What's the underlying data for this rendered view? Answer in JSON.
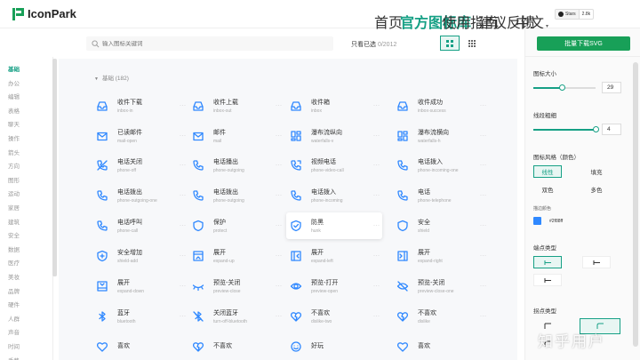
{
  "header": {
    "logo_text": "IconPark",
    "nav": [
      {
        "label": "首页",
        "active": false
      },
      {
        "label": "官方图标库",
        "active": true
      },
      {
        "label": "使用指南",
        "active": false
      },
      {
        "label": "建议反馈",
        "active": false
      }
    ],
    "lang": "中文",
    "github": {
      "label": "Stars",
      "count": "2.8k"
    }
  },
  "sidebar": {
    "items": [
      {
        "label": "基础",
        "active": true
      },
      {
        "label": "办公",
        "active": false
      },
      {
        "label": "编辑",
        "active": false
      },
      {
        "label": "表格",
        "active": false
      },
      {
        "label": "聊天",
        "active": false
      },
      {
        "label": "操作",
        "active": false
      },
      {
        "label": "箭头",
        "active": false
      },
      {
        "label": "方向",
        "active": false
      },
      {
        "label": "图形",
        "active": false
      },
      {
        "label": "运动",
        "active": false
      },
      {
        "label": "家居",
        "active": false
      },
      {
        "label": "建筑",
        "active": false
      },
      {
        "label": "安全",
        "active": false
      },
      {
        "label": "数据",
        "active": false
      },
      {
        "label": "医疗",
        "active": false
      },
      {
        "label": "美妆",
        "active": false
      },
      {
        "label": "品牌",
        "active": false
      },
      {
        "label": "硬件",
        "active": false
      },
      {
        "label": "人群",
        "active": false
      },
      {
        "label": "声音",
        "active": false
      },
      {
        "label": "时间",
        "active": false
      },
      {
        "label": "手势",
        "active": false
      }
    ]
  },
  "search": {
    "placeholder": "输入图标关键词"
  },
  "only_selected": {
    "label": "只看已选",
    "count": "0/2012"
  },
  "section": {
    "title": "基础 (182)"
  },
  "icons": [
    {
      "name": "收件下载",
      "code": "inbox-in",
      "icon": "inbox-in-icon"
    },
    {
      "name": "收件上载",
      "code": "inbox-out",
      "icon": "inbox-out-icon"
    },
    {
      "name": "收件箱",
      "code": "inbox",
      "icon": "inbox-icon"
    },
    {
      "name": "收件成功",
      "code": "inbox-success",
      "icon": "inbox-success-icon"
    },
    {
      "name": "已读邮件",
      "code": "mail-open",
      "icon": "mail-open-icon"
    },
    {
      "name": "邮件",
      "code": "mail",
      "icon": "mail-icon"
    },
    {
      "name": "瀑布流纵向",
      "code": "waterfalls-v",
      "icon": "waterfalls-v-icon"
    },
    {
      "name": "瀑布流横向",
      "code": "waterfalls-h",
      "icon": "waterfalls-h-icon"
    },
    {
      "name": "电话关闭",
      "code": "phone-off",
      "icon": "phone-off-icon"
    },
    {
      "name": "电话播出",
      "code": "phone-outgoing",
      "icon": "phone-outgoing-icon"
    },
    {
      "name": "视频电话",
      "code": "phone-video-call",
      "icon": "phone-video-call-icon"
    },
    {
      "name": "电话拨入",
      "code": "phone-incoming-one",
      "icon": "phone-incoming-icon"
    },
    {
      "name": "电话拨出",
      "code": "phone-outgoing-one",
      "icon": "phone-outgoing-one-icon"
    },
    {
      "name": "电话拨出",
      "code": "phone-outgoing",
      "icon": "phone-outgoing-icon"
    },
    {
      "name": "电话拨入",
      "code": "phone-incoming",
      "icon": "phone-incoming-icon"
    },
    {
      "name": "电话",
      "code": "phone-telephone",
      "icon": "phone-icon"
    },
    {
      "name": "电话呼叫",
      "code": "phone-call",
      "icon": "phone-call-icon"
    },
    {
      "name": "保护",
      "code": "protect",
      "icon": "protect-icon"
    },
    {
      "name": "防黑",
      "code": "hunk",
      "icon": "shield-check-icon"
    },
    {
      "name": "安全",
      "code": "shield",
      "icon": "shield-icon"
    },
    {
      "name": "安全增加",
      "code": "shield-add",
      "icon": "shield-add-icon"
    },
    {
      "name": "展开",
      "code": "expand-up",
      "icon": "expand-up-icon"
    },
    {
      "name": "展开",
      "code": "expand-left",
      "icon": "expand-left-icon"
    },
    {
      "name": "展开",
      "code": "expand-right",
      "icon": "expand-right-icon"
    },
    {
      "name": "展开",
      "code": "expand-down",
      "icon": "expand-down-icon"
    },
    {
      "name": "预览-关闭",
      "code": "preview-close",
      "icon": "preview-close-icon"
    },
    {
      "name": "预览-打开",
      "code": "preview-open",
      "icon": "preview-open-icon"
    },
    {
      "name": "预览-关闭",
      "code": "preview-close-one",
      "icon": "preview-close-one-icon"
    },
    {
      "name": "蓝牙",
      "code": "bluetooth",
      "icon": "bluetooth-icon"
    },
    {
      "name": "关闭蓝牙",
      "code": "turn-off-bluetooth",
      "icon": "bluetooth-off-icon"
    },
    {
      "name": "不喜欢",
      "code": "dislike-two",
      "icon": "dislike-two-icon"
    },
    {
      "name": "不喜欢",
      "code": "dislike",
      "icon": "dislike-icon"
    },
    {
      "name": "喜欢",
      "code": "",
      "icon": "like-icon"
    },
    {
      "name": "不喜欢",
      "code": "",
      "icon": "dislike-icon"
    },
    {
      "name": "好玩",
      "code": "",
      "icon": "fun-icon"
    },
    {
      "name": "喜欢",
      "code": "",
      "icon": "like-icon"
    }
  ],
  "panel": {
    "download_label": "批量下载SVG",
    "size_label": "图标大小",
    "size_value": "29",
    "size_fraction": 0.45,
    "stroke_label": "线段粗细",
    "stroke_value": "4",
    "stroke_fraction": 1.0,
    "style_label": "图标风格（颜色）",
    "styles": [
      {
        "label": "线性",
        "active": true
      },
      {
        "label": "填充",
        "active": false
      },
      {
        "label": "双色",
        "active": false
      },
      {
        "label": "多色",
        "active": false
      }
    ],
    "color_label": "描边颜色",
    "color_value": "#2f88ff",
    "color_hex_display": "#2f88ff",
    "endpoint_label": "端点类型",
    "endpoint_opts": [
      "",
      "",
      ""
    ],
    "corner_label": "拐点类型",
    "accent": "#16a085",
    "brand": "#18a058"
  },
  "watermark": "知乎用户"
}
